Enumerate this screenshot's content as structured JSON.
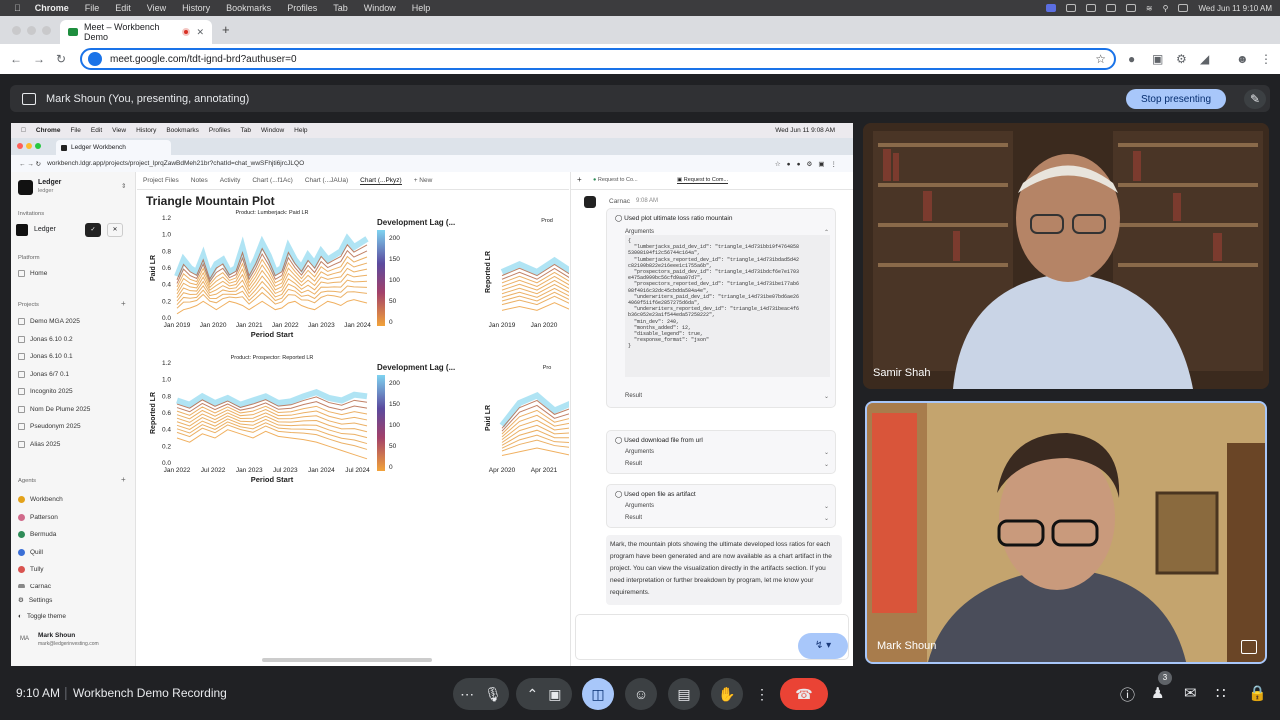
{
  "mac": {
    "app": "Chrome",
    "menus": [
      "File",
      "Edit",
      "View",
      "History",
      "Bookmarks",
      "Profiles",
      "Tab",
      "Window",
      "Help"
    ],
    "clock": "Wed Jun 11  9:10 AM"
  },
  "browser": {
    "tab_title": "Meet – Workbench Demo",
    "url": "meet.google.com/tdt-ignd-brd?authuser=0"
  },
  "meet": {
    "presenting": "Mark Shoun (You, presenting, annotating)",
    "stop": "Stop presenting",
    "time": "9:10 AM",
    "meeting": "Workbench Demo Recording",
    "participants_count": "3",
    "p1": "Samir Shah",
    "p2": "Mark Shoun"
  },
  "inner": {
    "mac": {
      "app": "Chrome",
      "menus": [
        "File",
        "Edit",
        "View",
        "History",
        "Bookmarks",
        "Profiles",
        "Tab",
        "Window",
        "Help"
      ],
      "clock": "Wed Jun 11  9:08 AM"
    },
    "tab": "Ledger Workbench",
    "url": "workbench.ldgr.app/projects/project_lprqZawBdMeh21br?chatId=chat_wwSFhjti6jrcJLQO",
    "org": {
      "name": "Ledger",
      "sub": "ledger"
    },
    "invitations": "Invitations",
    "invite_name": "Ledger",
    "platform": "Platform",
    "home": "Home",
    "projects": "Projects",
    "project_items": [
      "Demo MGA 2025",
      "Jonas 6.10 0.2",
      "Jonas 6.10 0.1",
      "Jonas 6/7 0.1",
      "Incognito 2025",
      "Nom De Plume 2025",
      "Pseudonym 2025",
      "Alias 2025"
    ],
    "agents": "Agents",
    "agent_items": [
      {
        "name": "Workbench",
        "color": "#e3a21a"
      },
      {
        "name": "Patterson",
        "color": "#d06a8a"
      },
      {
        "name": "Bermuda",
        "color": "#2e8b57"
      },
      {
        "name": "Quill",
        "color": "#3b6fd6"
      },
      {
        "name": "Tully",
        "color": "#d9534f"
      },
      {
        "name": "Carnac",
        "color": "#888888"
      }
    ],
    "settings": "Settings",
    "toggle_theme": "Toggle theme",
    "user": {
      "initials": "MA",
      "name": "Mark Shoun",
      "email": "mark@ledgerinvesting.com"
    },
    "ptabs": [
      "Project Files",
      "Notes",
      "Activity",
      "Chart (...f1Ac)",
      "Chart (...JAUa)",
      "Chart (...Pkyz)",
      "+ New"
    ],
    "plot_title": "Triangle Mountain Plot",
    "chat_tabs": [
      "Request to Co...",
      "Request to Com..."
    ],
    "agent_name": "Carnac",
    "agent_time": "9:08 AM",
    "tool1": "Used plot ultimate loss ratio mountain",
    "arguments": "Arguments",
    "result": "Result",
    "code": "{\n  \"lumberjacks_paid_dev_id\": \"triangle_14d731bb19f4764858\n53008104f12c56744c164a\",\n  \"lumberjacks_reported_dev_id\": \"triangle_14d731bdad5d42\nc82100b822e216eee1c1755a6b\",\n  \"prospectors_paid_dev_id\": \"triangle_14d731bdcf6e7e1703\ne475ad999bc56cfd9aa07d7\",\n  \"prospectors_reported_dev_id\": \"triangle_14d731be177ab6\n08f4016c32dc45cbdda584a4e\",\n  \"underwriters_paid_dev_id\": \"triangle_14d731be07bd6ae26\n4060f511f6e2857275d6da\",\n  \"underwriters_reported_dev_id\": \"triangle_14d731beac4f6\nb36c052e23a1f544eda57258222\",\n  \"min_dev\": 240,\n  \"months_added\": 12,\n  \"disable_legend\": true,\n  \"response_format\": \"json\"\n}",
    "tool2": "Used download file from url",
    "tool3": "Used open file as artifact",
    "message": "Mark, the mountain plots showing the ultimate developed loss ratios for each program have been generated and are now available as a chart artifact in the project. You can view the visualization directly in the artifacts section. If you need interpretation or further breakdown by program, let me know your requirements."
  },
  "chart_data": [
    {
      "type": "area",
      "title": "Product: Lumberjack: Paid LR",
      "xlabel": "Period Start",
      "ylabel": "Paid LR",
      "ylim": [
        0,
        1.2
      ],
      "yticks": [
        "0.0",
        "0.2",
        "0.4",
        "0.6",
        "0.8",
        "1.0",
        "1.2"
      ],
      "xticks": [
        "Jan 2019",
        "Jan 2020",
        "Jan 2021",
        "Jan 2022",
        "Jan 2023",
        "Jan 2024"
      ],
      "legend_title": "Development Lag (...",
      "legend_ticks": [
        "200",
        "150",
        "100",
        "50",
        "0"
      ],
      "upper": [
        0.5,
        0.7,
        0.6,
        0.55,
        0.75,
        0.5,
        0.65,
        0.7,
        0.55,
        0.6,
        0.85,
        0.55,
        0.7,
        0.9,
        0.75,
        0.55,
        0.6,
        0.85,
        0.7,
        0.6,
        0.75,
        0.65,
        0.8,
        0.7,
        0.75,
        0.8,
        0.95,
        0.85,
        0.9,
        0.95
      ],
      "lower": [
        0.05,
        0.1,
        0.12,
        0.15,
        0.2,
        0.15,
        0.1,
        0.15,
        0.2,
        0.18,
        0.15,
        0.1,
        0.15,
        0.2,
        0.15,
        0.1,
        0.12,
        0.18,
        0.2,
        0.15,
        0.12,
        0.1,
        0.15,
        0.2,
        0.18,
        0.15,
        0.2,
        0.22,
        0.2,
        0.18
      ]
    },
    {
      "type": "area",
      "title": "Product: Prospector: Reported LR",
      "xlabel": "Period Start",
      "ylabel": "Reported LR",
      "ylim": [
        0,
        1.2
      ],
      "yticks": [
        "0.0",
        "0.2",
        "0.4",
        "0.6",
        "0.8",
        "1.0",
        "1.2"
      ],
      "xticks": [
        "Jan 2022",
        "Jul 2022",
        "Jan 2023",
        "Jul 2023",
        "Jan 2024",
        "Jul 2024"
      ],
      "legend_title": "Development Lag (...",
      "legend_ticks": [
        "200",
        "150",
        "100",
        "50",
        "0"
      ],
      "upper": [
        0.75,
        0.7,
        0.8,
        0.72,
        0.78,
        0.7,
        0.75,
        0.8,
        0.72,
        0.74,
        0.8,
        0.85,
        0.78,
        0.75,
        0.82,
        0.8
      ],
      "lower": [
        0.3,
        0.25,
        0.35,
        0.3,
        0.4,
        0.35,
        0.3,
        0.38,
        0.32,
        0.3,
        0.28,
        0.25,
        0.2,
        0.15,
        0.1,
        0.05
      ]
    },
    {
      "type": "area",
      "title": "Prod",
      "xlabel": "",
      "ylabel": "Reported LR",
      "xticks": [
        "Jan 2019",
        "Jan 2020"
      ],
      "upper": [
        0.6,
        0.7,
        0.6,
        0.75,
        0.6
      ],
      "lower": [
        0.1,
        0.15,
        0.1,
        0.2,
        0.1
      ]
    },
    {
      "type": "area",
      "title": "Pro",
      "xlabel": "",
      "ylabel": "Paid LR",
      "xticks": [
        "Apr 2020",
        "Apr 2021"
      ],
      "upper": [
        0.5,
        0.8,
        0.9,
        0.7,
        0.8
      ],
      "lower": [
        0.1,
        0.15,
        0.2,
        0.15,
        0.1
      ]
    }
  ]
}
